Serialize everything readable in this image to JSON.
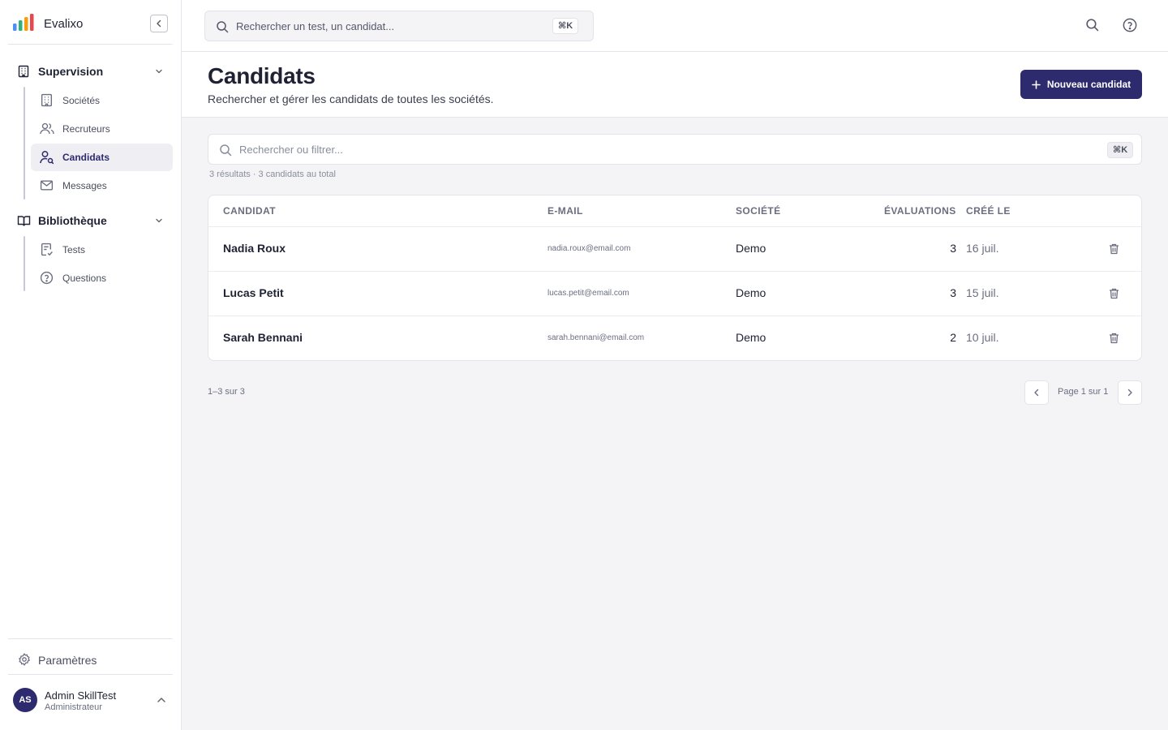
{
  "app": {
    "name": "Evalixo"
  },
  "sidebar": {
    "groups": [
      {
        "label": "Supervision",
        "items": [
          {
            "label": "Sociétés",
            "icon": "building-icon"
          },
          {
            "label": "Recruteurs",
            "icon": "users-icon"
          },
          {
            "label": "Candidats",
            "icon": "user-search-icon",
            "active": true
          },
          {
            "label": "Messages",
            "icon": "mail-icon"
          }
        ]
      },
      {
        "label": "Bibliothèque",
        "items": [
          {
            "label": "Tests",
            "icon": "clipboard-check-icon"
          },
          {
            "label": "Questions",
            "icon": "help-circle-icon"
          }
        ]
      }
    ],
    "settings_label": "Paramètres",
    "user": {
      "initials": "AS",
      "name": "Admin SkillTest",
      "role": "Administrateur"
    }
  },
  "topbar": {
    "search_placeholder": "Rechercher un test, un candidat...",
    "shortcut": "⌘K"
  },
  "page": {
    "title": "Candidats",
    "subtitle": "Rechercher et gérer les candidats de toutes les sociétés.",
    "new_button_label": "Nouveau candidat"
  },
  "filter": {
    "placeholder": "Rechercher ou filtrer...",
    "shortcut": "⌘K",
    "summary": "3 résultats · 3 candidats au total"
  },
  "table": {
    "columns": [
      "CANDIDAT",
      "E-MAIL",
      "SOCIÉTÉ",
      "ÉVALUATIONS",
      "CRÉÉ LE"
    ],
    "rows": [
      {
        "name": "Nadia Roux",
        "email": "nadia.roux@email.com",
        "company": "Demo",
        "evaluations": "3",
        "created": "16 juil."
      },
      {
        "name": "Lucas Petit",
        "email": "lucas.petit@email.com",
        "company": "Demo",
        "evaluations": "3",
        "created": "15 juil."
      },
      {
        "name": "Sarah Bennani",
        "email": "sarah.bennani@email.com",
        "company": "Demo",
        "evaluations": "2",
        "created": "10 juil."
      }
    ]
  },
  "pagination": {
    "range": "1–3 sur 3",
    "page_label": "Page 1 sur 1"
  },
  "colors": {
    "primary": "#2d2a6e",
    "logo_bars": [
      "#4f8ff7",
      "#2fb37a",
      "#f59e0b",
      "#e5484d"
    ]
  }
}
